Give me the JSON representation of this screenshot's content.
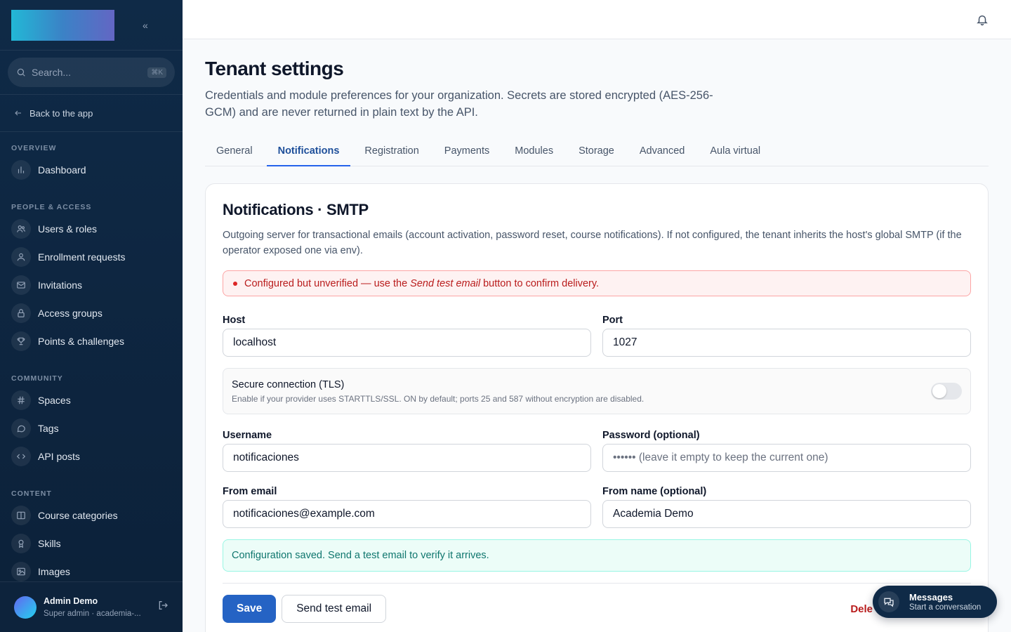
{
  "sidebar": {
    "search_placeholder": "Search...",
    "search_shortcut": "⌘K",
    "back_label": "Back to the app",
    "sections": [
      {
        "title": "OVERVIEW",
        "items": [
          {
            "label": "Dashboard",
            "icon": "bar-chart-icon"
          }
        ]
      },
      {
        "title": "PEOPLE & ACCESS",
        "items": [
          {
            "label": "Users & roles",
            "icon": "users-icon"
          },
          {
            "label": "Enrollment requests",
            "icon": "user-icon"
          },
          {
            "label": "Invitations",
            "icon": "mail-icon"
          },
          {
            "label": "Access groups",
            "icon": "lock-icon"
          },
          {
            "label": "Points & challenges",
            "icon": "trophy-icon"
          }
        ]
      },
      {
        "title": "COMMUNITY",
        "items": [
          {
            "label": "Spaces",
            "icon": "hash-icon"
          },
          {
            "label": "Tags",
            "icon": "chat-bubble-icon"
          },
          {
            "label": "API posts",
            "icon": "code-icon"
          }
        ]
      },
      {
        "title": "CONTENT",
        "items": [
          {
            "label": "Course categories",
            "icon": "book-icon"
          },
          {
            "label": "Skills",
            "icon": "award-icon"
          },
          {
            "label": "Images",
            "icon": "image-icon"
          }
        ]
      }
    ],
    "user": {
      "name": "Admin Demo",
      "role": "Super admin · academia-..."
    }
  },
  "page": {
    "title": "Tenant settings",
    "description": "Credentials and module preferences for your organization. Secrets are stored encrypted (AES-256-GCM) and are never returned in plain text by the API."
  },
  "tabs": [
    "General",
    "Notifications",
    "Registration",
    "Payments",
    "Modules",
    "Storage",
    "Advanced",
    "Aula virtual"
  ],
  "active_tab": "Notifications",
  "card": {
    "title": "Notifications · SMTP",
    "description": "Outgoing server for transactional emails (account activation, password reset, course notifications). If not configured, the tenant inherits the host's global SMTP (if the operator exposed one via env).",
    "warning": {
      "before": "Configured but unverified — use the",
      "emphasis": "Send test email",
      "after": "button to confirm delivery."
    },
    "host": {
      "label": "Host",
      "value": "localhost"
    },
    "port": {
      "label": "Port",
      "value": "1027"
    },
    "tls": {
      "title": "Secure connection (TLS)",
      "subtitle": "Enable if your provider uses STARTTLS/SSL. ON by default; ports 25 and 587 without encryption are disabled.",
      "enabled": false
    },
    "username": {
      "label": "Username",
      "value": "notificaciones"
    },
    "password": {
      "label": "Password (optional)",
      "placeholder": "•••••• (leave it empty to keep the current one)"
    },
    "from_email": {
      "label": "From email",
      "value": "notificaciones@example.com"
    },
    "from_name": {
      "label": "From name (optional)",
      "value": "Academia Demo"
    },
    "success": "Configuration saved. Send a test email to verify it arrives.",
    "save_label": "Save",
    "test_label": "Send test email",
    "delete_label": "Dele"
  },
  "messages": {
    "title": "Messages",
    "subtitle": "Start a conversation"
  },
  "colors": {
    "sidebar": "#0f2a47",
    "primary": "#2563c4",
    "danger": "#b91c1c",
    "success": "#0f766e"
  }
}
